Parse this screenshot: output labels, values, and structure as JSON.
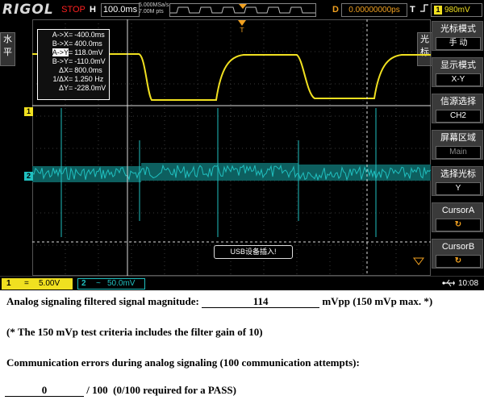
{
  "scope": {
    "brand": "RIGOL",
    "run_state": "STOP",
    "timebase_label": "H",
    "timebase": "100.0ms",
    "sample_rate": "5.000MSa/s",
    "memory_depth": "7.00M pts",
    "delay_label": "D",
    "delay": "0.00000000ps",
    "trigger_label": "T",
    "trigger_channel": "1",
    "trigger_level": "980mV",
    "left_tab": [
      "水",
      "平"
    ],
    "right_tab": [
      "光",
      "标"
    ],
    "cursor_readout": [
      {
        "key": "A->X",
        "value": "-400.0ms"
      },
      {
        "key": "B->X",
        "value": "400.0ms"
      },
      {
        "key": "A->Y",
        "value": "118.0mV"
      },
      {
        "key": "B->Y",
        "value": "-110.0mV"
      },
      {
        "key": "ΔX",
        "value": "800.0ms"
      },
      {
        "key": "1/ΔX",
        "value": "1.250 Hz"
      },
      {
        "key": "ΔY",
        "value": "-228.0mV"
      }
    ],
    "menu": [
      {
        "title": "光标模式",
        "value": "手  动"
      },
      {
        "title": "显示模式",
        "value": "X-Y"
      },
      {
        "title": "信源选择",
        "value": "CH2"
      },
      {
        "title": "屏幕区域",
        "value": "Main"
      },
      {
        "title": "选择光标",
        "value": "Y"
      },
      {
        "title": "CursorA",
        "value": "↻"
      },
      {
        "title": "CursorB",
        "value": "↻"
      }
    ],
    "usb_message": "USB设备插入!",
    "ch1_marker": "1",
    "ch2_marker": "2",
    "ch1": {
      "number": "1",
      "coupling": "=",
      "scale": "5.00V"
    },
    "ch2": {
      "number": "2",
      "coupling": "~",
      "scale": "50.0mV"
    },
    "clock": "10:08",
    "colors": {
      "ch1": "#f0e020",
      "ch2": "#20c0c0",
      "trigger": "#f0a020",
      "stop": "#ff2020"
    },
    "icons": [
      "trigger-marker-icon",
      "usb-icon",
      "rising-edge-icon"
    ]
  },
  "report": {
    "line1_label": "Analog signaling filtered signal magnitude: ",
    "line1_value": "114",
    "line1_suffix": " mVpp (150 mVp max. *)",
    "line2": "(* The 150 mVp test criteria includes the filter gain of 10)",
    "line3": "Communication errors during analog signaling (100 communication attempts):",
    "line4_value": "0",
    "line4_suffix": " / 100  (0/100 required for a PASS)"
  }
}
